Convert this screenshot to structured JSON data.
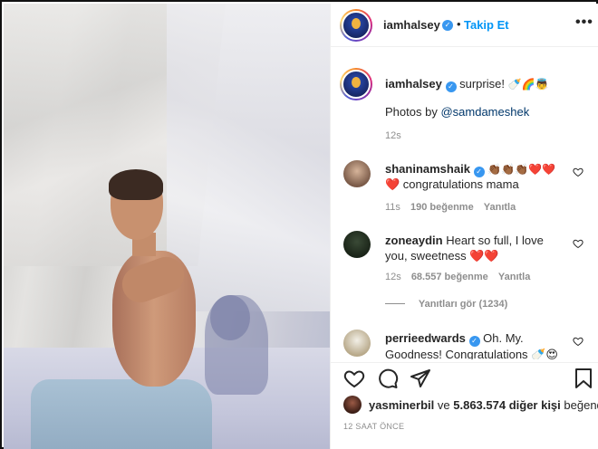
{
  "header": {
    "username": "iamhalsey",
    "separator": "•",
    "follow_label": "Takip Et",
    "more_icon": "more-dots-icon"
  },
  "caption": {
    "username": "iamhalsey",
    "text": "surprise!",
    "emojis": "🍼🌈👼",
    "photos_by_prefix": "Photos by",
    "photos_by_handle": "@samdameshek",
    "time": "12s"
  },
  "comments": [
    {
      "username": "shaninamshaik",
      "verified": true,
      "emoji_line": "👏🏾👏🏾👏🏾❤️❤️",
      "text": "❤️ congratulations mama",
      "time": "11s",
      "likes": "190 beğenme",
      "reply": "Yanıtla"
    },
    {
      "username": "zoneaydin",
      "verified": false,
      "text": "Heart so full, I love you, sweetness ❤️❤️",
      "time": "12s",
      "likes": "68.557 beğenme",
      "reply": "Yanıtla",
      "view_replies": "Yanıtları gör (1234)"
    },
    {
      "username": "perrieedwards",
      "verified": true,
      "text": "Oh. My. Goodness! Congratulations 🍼😍"
    }
  ],
  "actions": {
    "like_icon": "heart-icon",
    "comment_icon": "comment-icon",
    "share_icon": "share-icon",
    "save_icon": "bookmark-icon"
  },
  "likes_line": {
    "user": "yasminerbil",
    "connector": "ve",
    "others": "5.863.574 diğer kişi",
    "suffix": "beğendi"
  },
  "post_time": "12 SAAT ÖNCE"
}
